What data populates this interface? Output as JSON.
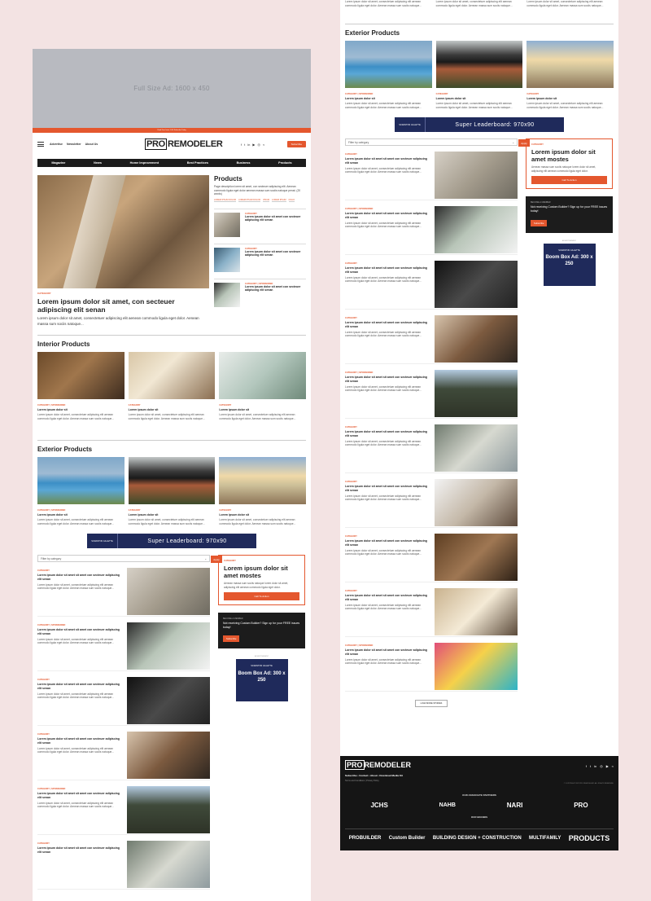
{
  "header": {
    "ad_label": "Full Size Ad: 1600 x 450",
    "promo_text": "Read Free Issue 1-5/6 Subscribe Today",
    "menu": [
      "Advertise",
      "Newsletter",
      "About Us"
    ],
    "logo_pro": "PRO",
    "logo_rest": "REMODELER",
    "subscribe": "Subscribe",
    "nav": [
      "Magazine",
      "News",
      "Home Improvement",
      "Best Practices",
      "Business",
      "Products"
    ]
  },
  "hero": {
    "category": "CATEGORY",
    "title": "Lorem ipsum dolor sit amet, con secteuer adipiscing elit senan",
    "desc": "Lorem ipsum dolor sit amet, consectetuer adipiscing elit aenean commodo ligula eget dolor. Aenean massa sum sociis natoque..."
  },
  "products": {
    "title": "Products",
    "desc": "Page description lorem sit amet, con secteuer adipiscing elit. Aenean commodo ligula eget dolor aenean massa sum sociis natoque penat. (20 words)",
    "tags": [
      "LOREM IPSUM DOLOR",
      "LOREM IPSUM DOLOR",
      "IPSUM",
      "LOREM IPSUM",
      "FOLIO"
    ],
    "items": [
      {
        "category": "CATEGORY",
        "title": "Lorem ipsum dolor sit amet con secteuer adipiscing elit senan"
      },
      {
        "category": "CATEGORY",
        "title": "Lorem ipsum dolor sit amet con secteuer adipiscing elit senan"
      },
      {
        "category": "CATEGORY | SPONSORED",
        "title": "Lorem ipsum dolor sit amet con secteuer adipiscing elit senan"
      }
    ]
  },
  "interior": {
    "title": "Interior Products",
    "cards": [
      {
        "category": "CATEGORY | SPONSORED",
        "title": "Lorem ipsum dolor sit",
        "desc": "Lorem ipsum dolor sit amet, consectetuer adipiscing elit aenean commodo ligula eget dolor. Aenean massa sum sociis natoque..."
      },
      {
        "category": "CATEGORY",
        "title": "Lorem ipsum dolor sit",
        "desc": "Lorem ipsum dolor sit amet, consectetuer adipiscing elit aenean commodo ligula eget dolor. Aenean massa sum sociis natoque..."
      },
      {
        "category": "CATEGORY",
        "title": "Lorem ipsum dolor sit",
        "desc": "Lorem ipsum dolor sit amet, consectetuer adipiscing elit aenean commodo ligula eget dolor. Aenean massa sum sociis natoque..."
      }
    ]
  },
  "exterior": {
    "title": "Exterior Products",
    "cards": [
      {
        "category": "CATEGORY | SPONSORED",
        "title": "Lorem ipsum dolor sit",
        "desc": "Lorem ipsum dolor sit amet, consectetuer adipiscing elit aenean commodo ligula eget dolor. Aenean massa sum sociis natoque..."
      },
      {
        "category": "CATEGORY",
        "title": "Lorem ipsum dolor sit",
        "desc": "Lorem ipsum dolor sit amet, consectetuer adipiscing elit aenean commodo ligula eget dolor. Aenean massa sum sociis natoque..."
      },
      {
        "category": "CATEGORY",
        "title": "Lorem ipsum dolor sit",
        "desc": "Lorem ipsum dolor sit amet, consectetuer adipiscing elit aenean commodo ligula eget dolor. Aenean massa sum sociis natoque..."
      }
    ]
  },
  "leaderboard": {
    "logo": "SCRANTON GILLETTE",
    "label": "Super Leaderboard: 970x90"
  },
  "filter": {
    "placeholder": "Filter by category",
    "go": "Apply"
  },
  "list": {
    "category": "CATEGORY",
    "sponsored": "CATEGORY | SPONSORED",
    "title": "Lorem ipsum dolor sit amet sit amet con secteuer adipiscing elit senan",
    "desc": "Lorem ipsum dolor sit amet, consectetuer adipiscing elit aenean commodo ligula eget dolor. Aenean massa sum sociis natoque..."
  },
  "sidebar": {
    "category": "CATEGORY",
    "title": "Lorem ipsum dolor sit amet mostes",
    "desc": "Aenean massa sum sociis natoque lorem dolor sit amet, adipiscing elit aenean commodo ligula eget dolor.",
    "button": "Call To Action",
    "newsletter_kicker": "BECOME A MEMBER",
    "newsletter_msg": "Not receiving Custom Builder? Sign up for your FREE issues today!",
    "newsletter_btn": "Subscribe",
    "boom_label": "ADVERTISEMENT",
    "boom_logo": "SCRANTON GILLETTE",
    "boom_text": "Boom Box Ad: 300 x 250"
  },
  "load_more": "LOAD MORE STORIES",
  "footer": {
    "links": "Subscribe • Contact • About • Download Media Kit",
    "terms": "Terms and Conditions | Privacy Policy",
    "copyright": "© COPYRIGHT 2022 PRO REMODELER. ALL RIGHTS RESERVED",
    "partners_title": "OUR ASSOCIATE PARTNERS",
    "partners": [
      "JCHS",
      "NAHB",
      "NARI",
      "PRO"
    ],
    "brands_title": "OUR BRANDS",
    "brands": [
      "PROBUILDER",
      "Custom Builder",
      "BUILDING DESIGN + CONSTRUCTION",
      "MULTIFAMILY",
      "PRODUCTS"
    ]
  },
  "colors": {
    "accent": "#e4572e",
    "dark": "#1c1c1c",
    "ad_navy": "#1f2a5b"
  }
}
